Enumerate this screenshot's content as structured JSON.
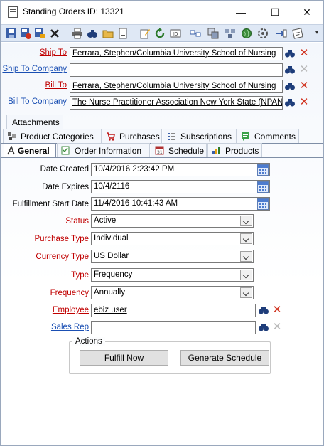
{
  "window": {
    "title": "Standing Orders ID: 13321",
    "minimize": "—",
    "maximize": "☐",
    "close": "✕"
  },
  "toolbar": {
    "icons": [
      "save-icon",
      "save-close-icon",
      "save-new-icon",
      "delete-icon",
      "print-icon",
      "find-icon",
      "open-folder-icon",
      "report-icon",
      "edit-icon",
      "refresh-icon",
      "id-icon",
      "link-icon",
      "copy-icon",
      "globe-icon",
      "settings-icon",
      "import-icon",
      "notes-icon"
    ],
    "overflow": "▾"
  },
  "links": {
    "ship_to": {
      "label": "Ship To",
      "value": "Ferrara, Stephen/Columbia University School of Nursing"
    },
    "ship_to_company": {
      "label": "Ship To Company",
      "value": ""
    },
    "bill_to": {
      "label": "Bill To",
      "value": "Ferrara, Stephen/Columbia University School of Nursing"
    },
    "bill_to_company": {
      "label": "Bill To Company",
      "value": "The Nurse Practitioner Association New York State (NPANY"
    }
  },
  "tabs_row1": [
    {
      "label": "Attachments"
    }
  ],
  "tabs_row2": [
    {
      "label": "Product Categories"
    },
    {
      "label": "Purchases"
    },
    {
      "label": "Subscriptions"
    },
    {
      "label": "Comments"
    }
  ],
  "tabs_row3": [
    {
      "label": "General"
    },
    {
      "label": "Order Information"
    },
    {
      "label": "Schedule"
    },
    {
      "label": "Products"
    }
  ],
  "form": {
    "date_created": {
      "label": "Date Created",
      "value": "10/4/2016 2:23:42 PM"
    },
    "date_expires": {
      "label": "Date Expires",
      "value": "10/4/2116"
    },
    "fulfillment_start": {
      "label": "Fulfillment Start Date",
      "value": "11/4/2016 10:41:43 AM"
    },
    "status": {
      "label": "Status",
      "value": "Active"
    },
    "purchase_type": {
      "label": "Purchase Type",
      "value": "Individual"
    },
    "currency_type": {
      "label": "Currency Type",
      "value": "US Dollar"
    },
    "type": {
      "label": "Type",
      "value": "Frequency"
    },
    "frequency": {
      "label": "Frequency",
      "value": "Annually"
    },
    "employee": {
      "label": "Employee",
      "value": "ebiz user"
    },
    "sales_rep": {
      "label": "Sales Rep",
      "value": ""
    }
  },
  "actions": {
    "title": "Actions",
    "fulfill_now": "Fulfill Now",
    "generate_schedule": "Generate Schedule"
  },
  "colors": {
    "required_label": "#c00000",
    "link_label": "#1a4fb3",
    "toolbar_bg": "#dfe8f5"
  }
}
